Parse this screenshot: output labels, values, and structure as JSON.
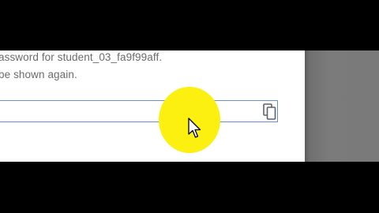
{
  "dialog": {
    "message_line1": "assword for student_03_fa9f99aff.",
    "message_line2": " be shown again.",
    "password_field": {
      "value": ""
    },
    "copy_icon": "copy-icon"
  },
  "overlay": {
    "cursor_highlight_color": "#fbf00f",
    "cursor_icon": "mouse-pointer-icon"
  },
  "colors": {
    "letterbox": "#000000",
    "backdrop": "#7a7a7a",
    "text": "#6b6b6b",
    "field_border": "#6b8fc9"
  }
}
